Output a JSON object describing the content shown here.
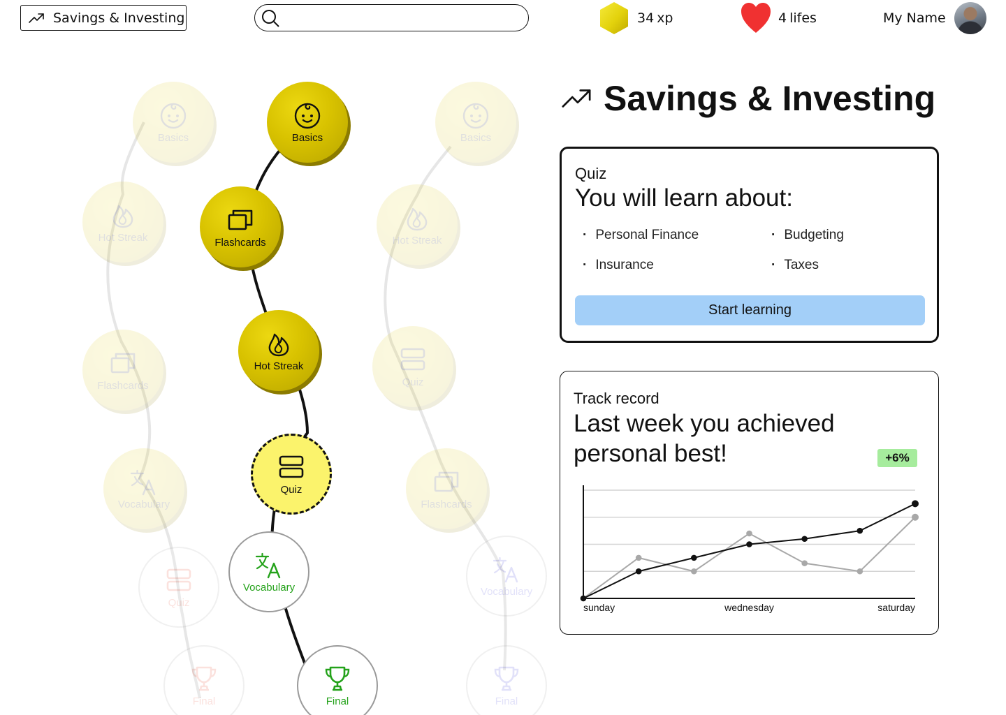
{
  "header": {
    "topic_label": "Savings & Investing",
    "search_placeholder": "",
    "xp_value": "34",
    "xp_unit": "xp",
    "lives_value": "4",
    "lives_unit": "lifes",
    "user_name": "My Name",
    "colors": {
      "xp_hexagon": "#e3d20c",
      "heart": "#f03131"
    }
  },
  "path": {
    "nodes": [
      {
        "id": "b1",
        "label": "Basics",
        "icon": "baby-face-icon",
        "state": "faded"
      },
      {
        "id": "b2",
        "label": "Hot Streak",
        "icon": "flame-icon",
        "state": "faded"
      },
      {
        "id": "b3",
        "label": "Flashcards",
        "icon": "cards-icon",
        "state": "faded"
      },
      {
        "id": "b4",
        "label": "Vocabulary",
        "icon": "translate-icon",
        "state": "faded"
      },
      {
        "id": "b5",
        "label": "Quiz",
        "icon": "quiz-icon",
        "state": "faded-open"
      },
      {
        "id": "b6",
        "label": "Final",
        "icon": "trophy-icon",
        "state": "faded-open"
      },
      {
        "id": "m1",
        "label": "Basics",
        "icon": "baby-face-icon",
        "state": "done"
      },
      {
        "id": "m2",
        "label": "Flashcards",
        "icon": "cards-icon",
        "state": "done"
      },
      {
        "id": "m3",
        "label": "Hot Streak",
        "icon": "flame-icon",
        "state": "done"
      },
      {
        "id": "m4",
        "label": "Quiz",
        "icon": "quiz-icon",
        "state": "current"
      },
      {
        "id": "m5",
        "label": "Vocabulary",
        "icon": "translate-icon",
        "state": "open"
      },
      {
        "id": "m6",
        "label": "Final",
        "icon": "trophy-icon",
        "state": "open"
      },
      {
        "id": "r1",
        "label": "Basics",
        "icon": "baby-face-icon",
        "state": "faded"
      },
      {
        "id": "r2",
        "label": "Hot Streak",
        "icon": "flame-icon",
        "state": "faded"
      },
      {
        "id": "r3",
        "label": "Quiz",
        "icon": "quiz-icon",
        "state": "faded"
      },
      {
        "id": "r4",
        "label": "Flashcards",
        "icon": "cards-icon",
        "state": "faded"
      },
      {
        "id": "r5",
        "label": "Vocabulary",
        "icon": "translate-icon",
        "state": "faded-open"
      },
      {
        "id": "r6",
        "label": "Final",
        "icon": "trophy-icon",
        "state": "faded-open"
      }
    ],
    "colors": {
      "done": "#d8c200",
      "current": "#fbf36c",
      "open_label": "#24a21a"
    }
  },
  "topic": {
    "title": "Savings & Investing"
  },
  "quiz_card": {
    "kicker": "Quiz",
    "title": "You will learn about:",
    "topics": [
      "Personal Finance",
      "Budgeting",
      "Insurance",
      "Taxes"
    ],
    "start_label": "Start learning",
    "button_color": "#a3cff8"
  },
  "record_card": {
    "kicker": "Track record",
    "title": "Last week you achieved personal best!",
    "badge": "+6%",
    "badge_color": "#a6ec9d"
  },
  "chart_data": {
    "type": "line",
    "x": [
      0,
      1,
      2,
      3,
      4,
      5,
      6
    ],
    "tick_labels": [
      "sunday",
      "",
      "",
      "wednesday",
      "",
      "",
      "saturday"
    ],
    "ylim": [
      0,
      4
    ],
    "grid": true,
    "series": [
      {
        "color": "#111111",
        "values": [
          0,
          1,
          1.5,
          2,
          2.2,
          2.5,
          3.5
        ]
      },
      {
        "color": "#a8a8a8",
        "values": [
          0,
          1.5,
          1,
          2.4,
          1.3,
          1,
          3
        ]
      }
    ]
  }
}
